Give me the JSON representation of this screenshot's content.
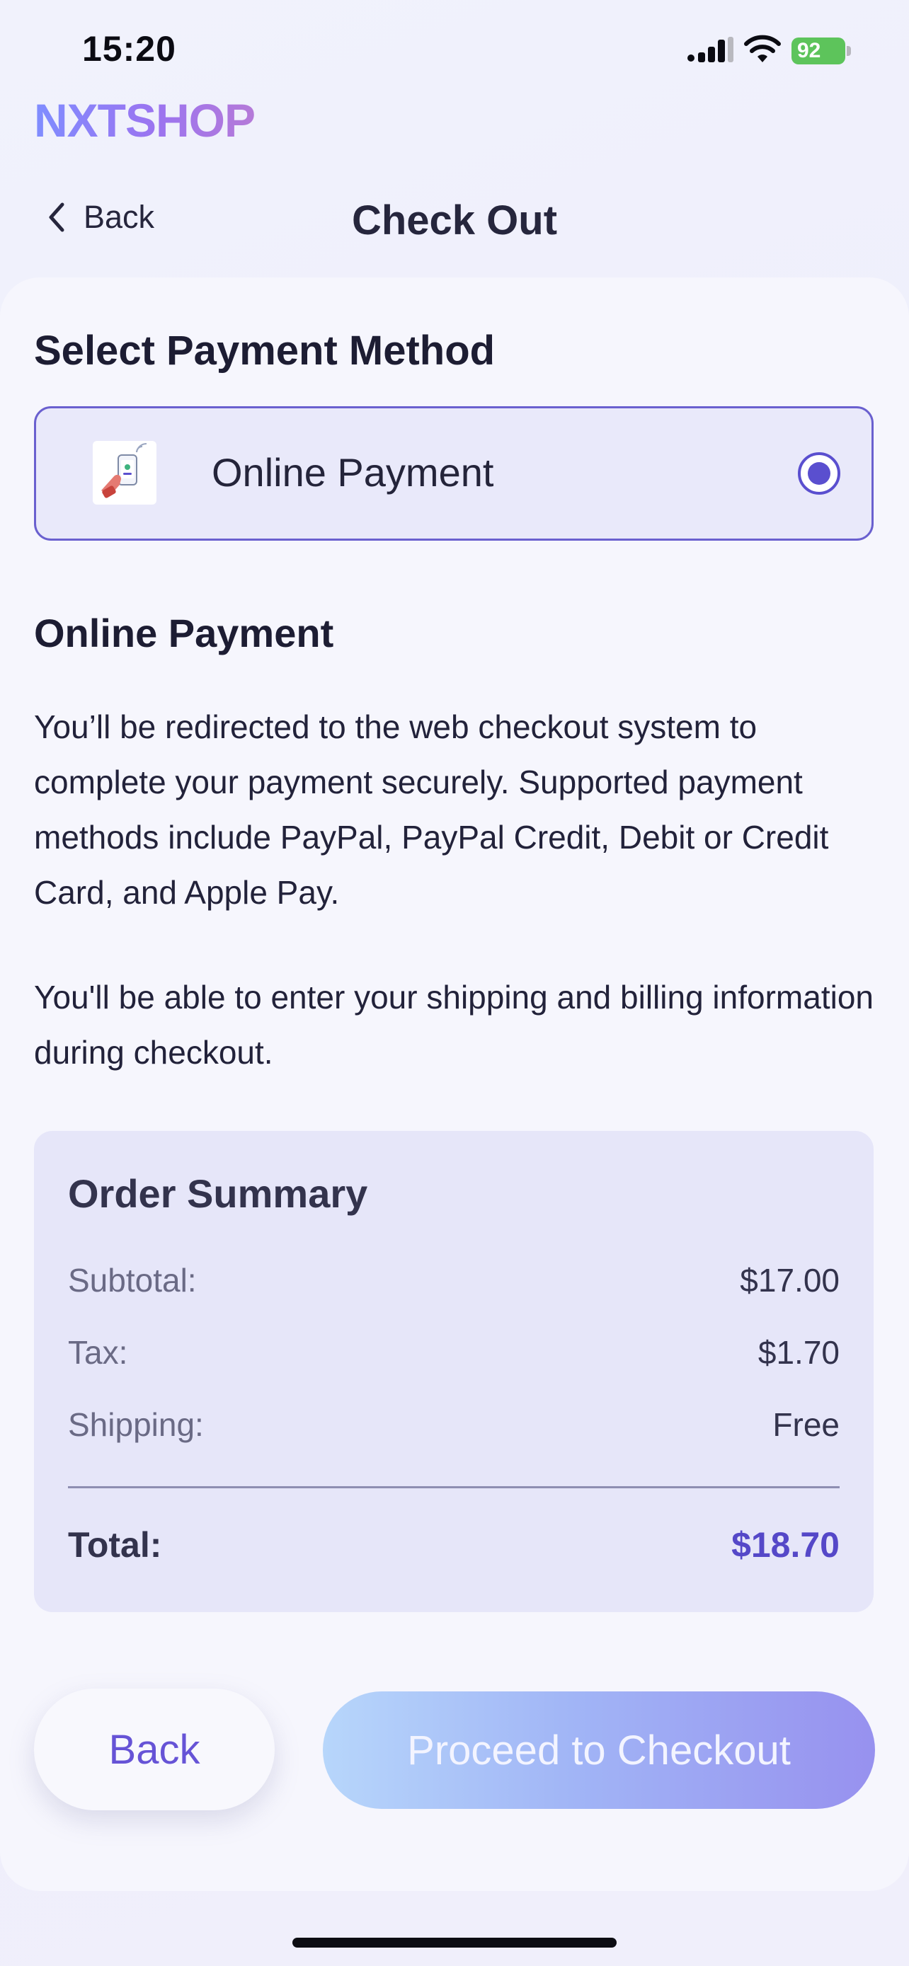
{
  "status_bar": {
    "time": "15:20",
    "battery_level": "92"
  },
  "brand": {
    "logo_text": "NXTSHOP"
  },
  "nav": {
    "back_label": "Back",
    "title": "Check Out"
  },
  "payment_section": {
    "title": "Select Payment Method",
    "selected_option": {
      "label": "Online Payment",
      "icon": "phone-payment-icon",
      "selected": true
    }
  },
  "info": {
    "title": "Online Payment",
    "paragraph_1": "You’ll be redirected to the web checkout system to complete your payment securely. Supported payment methods include PayPal, PayPal Credit, Debit or Credit Card, and Apple Pay.",
    "paragraph_2": "You'll be able to enter your shipping and billing information during checkout."
  },
  "order_summary": {
    "title": "Order Summary",
    "subtotal_label": "Subtotal:",
    "subtotal_value": "$17.00",
    "tax_label": "Tax:",
    "tax_value": "$1.70",
    "shipping_label": "Shipping:",
    "shipping_value": "Free",
    "total_label": "Total:",
    "total_value": "$18.70"
  },
  "actions": {
    "back_label": "Back",
    "proceed_label": "Proceed to Checkout"
  },
  "colors": {
    "accent": "#5a4fcf",
    "total": "#5548c8",
    "battery": "#5dc45b"
  }
}
